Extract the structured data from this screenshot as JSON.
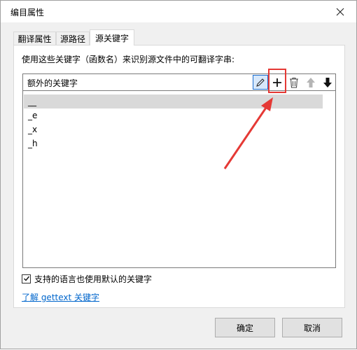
{
  "window": {
    "title": "编目属性"
  },
  "tabs": [
    {
      "label": "翻译属性",
      "active": false
    },
    {
      "label": "源路径",
      "active": false
    },
    {
      "label": "源关键字",
      "active": true
    }
  ],
  "panel": {
    "instruction": "使用这些关键字（函数名）来识别源文件中的可翻译字串:",
    "list_header": "额外的关键字",
    "toolbar": {
      "edit_icon": "pencil-icon",
      "add_icon": "plus-icon",
      "delete_icon": "trash-icon",
      "up_icon": "arrow-up-icon",
      "down_icon": "arrow-down-icon"
    },
    "keywords": [
      "__",
      "_e",
      "_x",
      "_h"
    ],
    "selected_index": 0,
    "checkbox_label": "支持的语言也使用默认的关键字",
    "checkbox_checked": true,
    "link_text": "了解 gettext 关键字"
  },
  "buttons": {
    "ok": "确定",
    "cancel": "取消"
  },
  "colors": {
    "annotation": "#e53935",
    "link": "#0066cc",
    "selection": "#d9d9d9"
  }
}
